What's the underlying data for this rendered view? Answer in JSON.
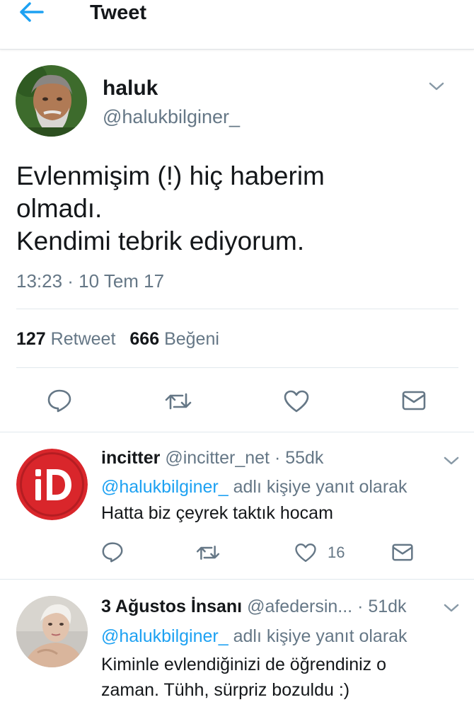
{
  "header": {
    "title": "Tweet",
    "back_icon": "arrow-left-icon"
  },
  "tweet": {
    "author_name": "haluk",
    "author_handle": "@halukbilginer_",
    "text_lines": [
      "Evlenmişim (!) hiç haberim",
      "olmadı.",
      "Kendimi tebrik ediyorum."
    ],
    "time": "13:23 · 10 Tem 17",
    "retweet_count": "127",
    "retweet_label": "Retweet",
    "like_count": "666",
    "like_label": "Beğeni"
  },
  "replies": [
    {
      "name": "incitter",
      "handle": "@incitter_net",
      "time": "· 55dk",
      "reply_to_mention": "@halukbilginer_",
      "reply_to_suffix": "adlı kişiye yanıt olarak",
      "text_lines": [
        "Hatta biz çeyrek taktık hocam"
      ],
      "like_count": "16"
    },
    {
      "name": "3 Ağustos İnsanı",
      "handle": "@afedersin...",
      "time": "· 51dk",
      "reply_to_mention": "@halukbilginer_",
      "reply_to_suffix": "adlı kişiye yanıt olarak",
      "text_lines": [
        "Kiminle evlendiğinizi de öğrendiniz o",
        "zaman. Tühh, sürpriz bozuldu :)"
      ]
    }
  ],
  "colors": {
    "accent": "#1da1f2",
    "secondary_text": "#657786",
    "primary_text": "#14171a",
    "divider": "#e1e8ed",
    "logo_red": "#d9262b"
  }
}
